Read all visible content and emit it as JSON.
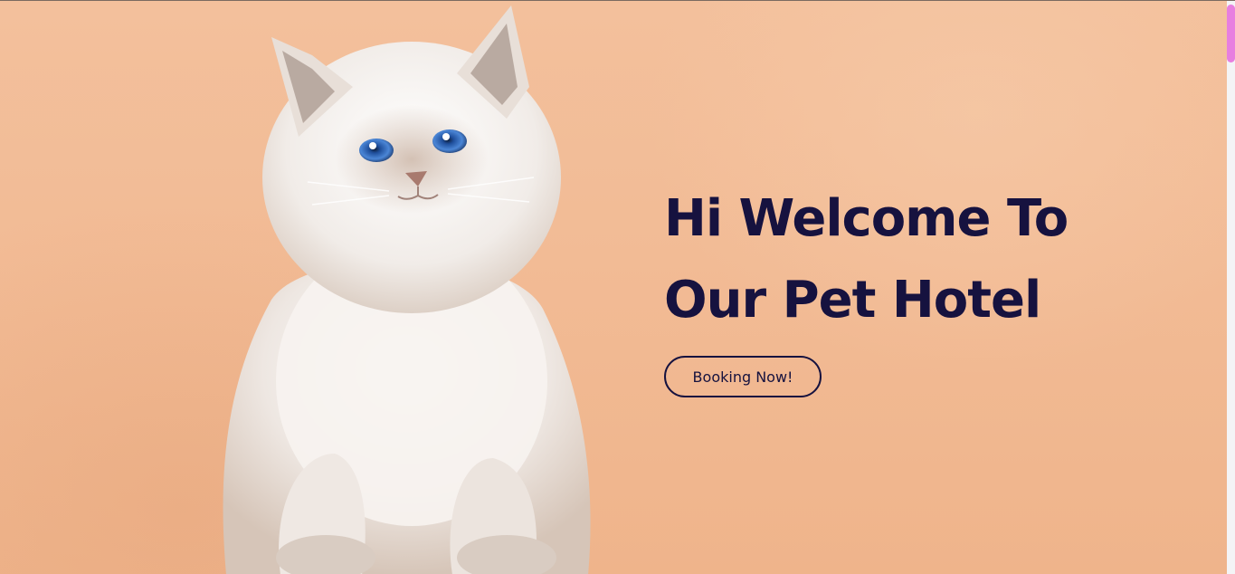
{
  "hero": {
    "headline_line1": "Hi Welcome To",
    "headline_line2": "Our Pet Hotel",
    "cta_label": "Booking Now!",
    "image": "white-fluffy-kitten-photo"
  },
  "colors": {
    "background": "#f2bb95",
    "headline": "#16123f",
    "scrollbar_thumb": "#e77ee0"
  }
}
